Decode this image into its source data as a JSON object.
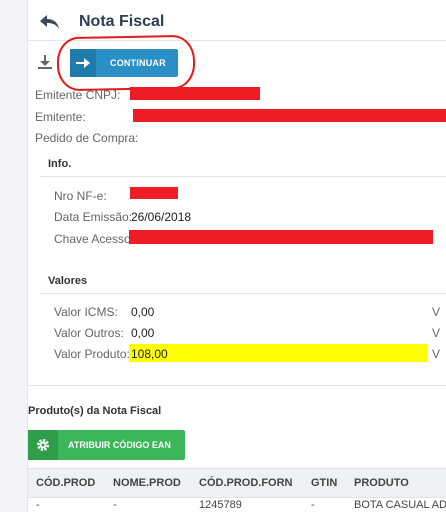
{
  "header": {
    "title": "Nota Fiscal",
    "back_icon": "back-arrow-icon"
  },
  "toolbar": {
    "download_icon": "download-icon",
    "continue_label": "CONTINUAR",
    "continue_icon": "arrow-right-icon"
  },
  "emitter": {
    "cnpj_label": "Emitente CNPJ:",
    "emitente_label": "Emitente:",
    "pedido_label": "Pedido de Compra:"
  },
  "info": {
    "title": "Info.",
    "nro_label": "Nro NF-e:",
    "data_label": "Data Emissão:",
    "data_value": "26/06/2018",
    "chave_label": "Chave Acesso:"
  },
  "valores": {
    "title": "Valores",
    "icms_label": "Valor ICMS:",
    "icms_value": "0,00",
    "outros_label": "Valor Outros:",
    "outros_value": "0,00",
    "produto_label": "Valor Produto:",
    "produto_value": "108,00",
    "right_col": [
      "V",
      "V",
      "V"
    ]
  },
  "produtos": {
    "title": "Produto(s) da Nota Fiscal",
    "ean_button_label": "ATRIBUIR CÓDIGO EAN",
    "ean_icon": "gear-icon",
    "columns": [
      "CÓD.PROD",
      "NOME.PROD",
      "CÓD.PROD.FORN",
      "GTIN",
      "PRODUTO"
    ],
    "rows": [
      [
        "-",
        "-",
        "1245789",
        "-",
        "BOTA CASUAL AD"
      ]
    ]
  },
  "colors": {
    "primary": "#2a8fc4",
    "success": "#3cb55b",
    "redaction": "#ee1c24",
    "highlight": "#ffff00",
    "annotation": "#e21b1b"
  }
}
